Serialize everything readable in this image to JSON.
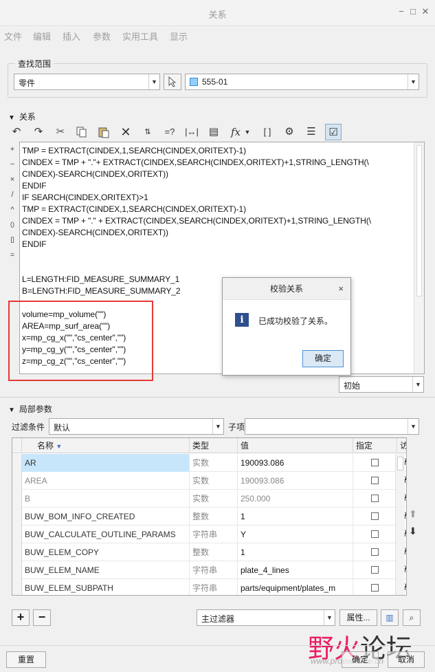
{
  "window": {
    "title": "关系",
    "min": "−",
    "max": "□",
    "close": "✕"
  },
  "menu": [
    "文件",
    "编辑",
    "插入",
    "参数",
    "实用工具",
    "显示"
  ],
  "search": {
    "label": "查找范围",
    "scope": "零件",
    "model": "555-01"
  },
  "relations": {
    "label": "关系",
    "side_ops": [
      "+",
      "−",
      "×",
      "/",
      "^",
      "()",
      "[]",
      "="
    ],
    "lines": [
      "TMP = EXTRACT(CINDEX,1,SEARCH(CINDEX,ORITEXT)-1)",
      "CINDEX = TMP + \".\"+  EXTRACT(CINDEX,SEARCH(CINDEX,ORITEXT)+1,STRING_LENGTH(\\",
      "CINDEX)-SEARCH(CINDEX,ORITEXT))",
      "ENDIF",
      "IF SEARCH(CINDEX,ORITEXT)>1",
      "TMP = EXTRACT(CINDEX,1,SEARCH(CINDEX,ORITEXT)-1)",
      "CINDEX = TMP + \".\" +  EXTRACT(CINDEX,SEARCH(CINDEX,ORITEXT)+1,STRING_LENGTH(\\",
      "CINDEX)-SEARCH(CINDEX,ORITEXT))",
      "ENDIF",
      "",
      "",
      "L=LENGTH:FID_MEASURE_SUMMARY_1",
      "B=LENGTH:FID_MEASURE_SUMMARY_2",
      "",
      "volume=mp_volume(\"\")",
      "AREA=mp_surf_area(\"\")",
      "x=mp_cg_x(\"\",\"cs_center\",\"\")",
      "y=mp_cg_y(\"\",\"cs_center\",\"\")",
      "z=mp_cg_z(\"\",\"cs_center\",\"\")"
    ],
    "units_combo": "初始"
  },
  "dialog": {
    "title": "校验关系",
    "message": "已成功校验了关系。",
    "ok": "确定",
    "close": "×",
    "icon": "i"
  },
  "local_params": {
    "label": "局部参数",
    "filter_label": "过滤条件",
    "filter_value": "默认",
    "child_label": "子项",
    "child_value": "",
    "columns": [
      "名称",
      "类型",
      "值",
      "指定",
      "访问"
    ],
    "rows": [
      {
        "name": "AR",
        "type": "实数",
        "value": "190093.086",
        "selected": true,
        "gray": false
      },
      {
        "name": "AREA",
        "type": "实数",
        "value": "190093.086",
        "selected": false,
        "gray": true
      },
      {
        "name": "B",
        "type": "实数",
        "value": "250.000",
        "selected": false,
        "gray": true
      },
      {
        "name": "BUW_BOM_INFO_CREATED",
        "type": "整数",
        "value": "1",
        "selected": false,
        "gray": false
      },
      {
        "name": "BUW_CALCULATE_OUTLINE_PARAMS",
        "type": "字符串",
        "value": "Y",
        "selected": false,
        "gray": false
      },
      {
        "name": "BUW_ELEM_COPY",
        "type": "整数",
        "value": "1",
        "selected": false,
        "gray": false
      },
      {
        "name": "BUW_ELEM_NAME",
        "type": "字符串",
        "value": "plate_4_lines",
        "selected": false,
        "gray": false
      },
      {
        "name": "BUW_ELEM_SUBPATH",
        "type": "字符串",
        "value": "parts/equipment/plates_m",
        "selected": false,
        "gray": false
      }
    ],
    "main_filter": "主过滤器",
    "properties": "属性..."
  },
  "bottom": {
    "reset": "重置",
    "ok": "确定",
    "cancel": "取消"
  },
  "watermark": {
    "text1": "野火",
    "text2": "论坛",
    "url": "www.proewildfire.cn"
  },
  "colors": {
    "selection": "#c8e6fb",
    "dialog_ok": "#dbe9f7",
    "highlight_box": "#e53935",
    "info_icon": "#2f4f8f"
  }
}
